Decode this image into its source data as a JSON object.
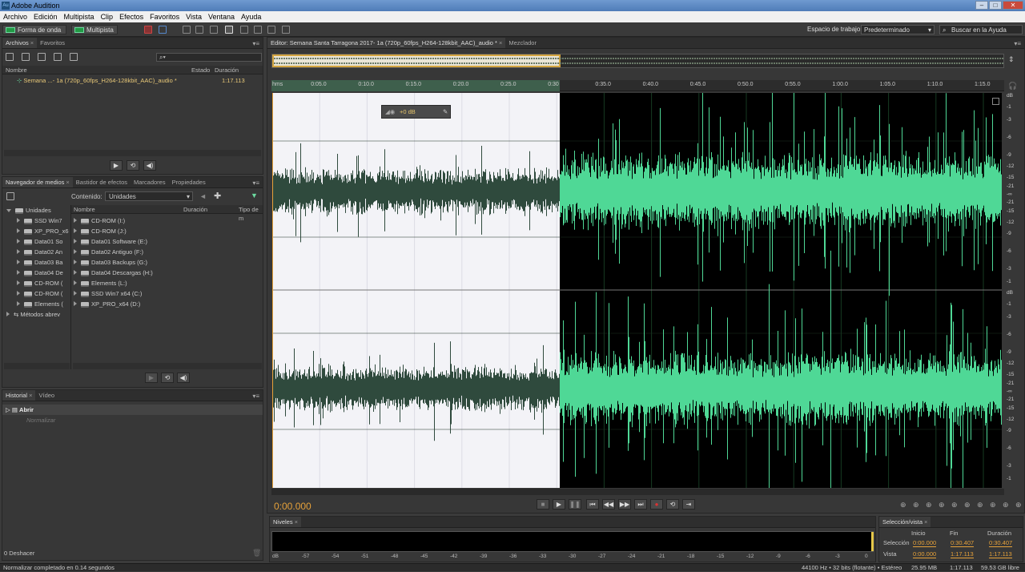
{
  "window": {
    "title": "Adobe Audition",
    "icon": "Au"
  },
  "menu": [
    "Archivo",
    "Edición",
    "Multipista",
    "Clip",
    "Efectos",
    "Favoritos",
    "Vista",
    "Ventana",
    "Ayuda"
  ],
  "toolbar": {
    "waveform_btn": "Forma de onda",
    "multitrack_btn": "Multipista",
    "workspace_label": "Espacio de trabajo:",
    "workspace_value": "Predeterminado",
    "help_search": "Buscar en la Ayuda"
  },
  "files_panel": {
    "tabs": [
      "Archivos",
      "Favoritos"
    ],
    "columns": [
      "Nombre",
      "Estado",
      "Duración"
    ],
    "items": [
      {
        "name": "Semana ...- 1a (720p_60fps_H264-128kbit_AAC)_audio *",
        "duration": "1:17.113"
      }
    ]
  },
  "media_panel": {
    "tabs": [
      "Navegador de medios",
      "Bastidor de efectos",
      "Marcadores",
      "Propiedades"
    ],
    "contents_label": "Contenido:",
    "contents_value": "Unidades",
    "columns": [
      "Nombre",
      "Duración",
      "Tipo de m"
    ],
    "tree": [
      "Unidades",
      "SSD Win7",
      "XP_PRO_x6",
      "Data01 So",
      "Data02 An",
      "Data03 Ba",
      "Data04 De",
      "CD-ROM (",
      "CD-ROM (",
      "Elements (",
      "Métodos abrev"
    ],
    "list": [
      "CD-ROM (I:)",
      "CD-ROM (J:)",
      "Data01 Software (E:)",
      "Data02 Antiguo (F:)",
      "Data03 Backups (G:)",
      "Data04 Descargas (H:)",
      "Elements (L:)",
      "SSD Win7 x64 (C:)",
      "XP_PRO_x64 (D:)"
    ]
  },
  "history_panel": {
    "tabs": [
      "Historial",
      "Vídeo"
    ],
    "items": [
      "Abrir",
      "Normalizar"
    ],
    "undo": "0 Deshacer"
  },
  "editor": {
    "tabs": [
      "Editor: Semana Santa Tarragona 2017- 1a (720p_60fps_H264-128kbit_AAC)_audio *",
      "Mezclador"
    ],
    "ruler": [
      "hms",
      "0:05.0",
      "0:10.0",
      "0:15.0",
      "0:20.0",
      "0:25.0",
      "0:30",
      "0:35.0",
      "0:40.0",
      "0:45.0",
      "0:50.0",
      "0:55.0",
      "1:00.0",
      "1:05.0",
      "1:10.0",
      "1:15.0"
    ],
    "hud_gain": "+0 dB",
    "db_scale": [
      "dB",
      "-1",
      "-3",
      "-6",
      "-9",
      "-12",
      "-15",
      "-21",
      "-∞",
      "-21",
      "-15",
      "-12",
      "-9",
      "-6",
      "-3",
      "-1"
    ],
    "current_time": "0:00.000",
    "waveform_colors": {
      "selected_bg": "#f3f3f7",
      "selected_wave": "#2f4a3d",
      "unselected_bg": "#000000",
      "unselected_wave": "#4fd896"
    }
  },
  "levels": {
    "tab": "Niveles",
    "scale": [
      "dB",
      "-57",
      "-54",
      "-51",
      "-48",
      "-45",
      "-42",
      "-39",
      "-36",
      "-33",
      "-30",
      "-27",
      "-24",
      "-21",
      "-18",
      "-15",
      "-12",
      "-9",
      "-6",
      "-3",
      "0"
    ]
  },
  "selection": {
    "tab": "Selección/vista",
    "headers": [
      "Inicio",
      "Fin",
      "Duración"
    ],
    "rows": [
      {
        "label": "Selección",
        "start": "0:00.000",
        "end": "0:30.407",
        "duration": "0:30.407"
      },
      {
        "label": "Vista",
        "start": "0:00.000",
        "end": "1:17.113",
        "duration": "1:17.113"
      }
    ]
  },
  "status": {
    "message": "Normalizar completado en 0.14 segundos",
    "sample": "44100 Hz • 32 bits (flotante) • Estéreo",
    "size": "25.95 MB",
    "duration": "1:17.113",
    "free": "59.53 GB libre"
  }
}
